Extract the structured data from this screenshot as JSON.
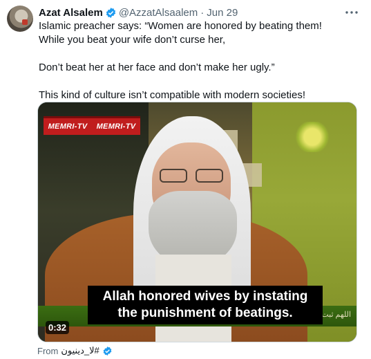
{
  "tweet": {
    "author": {
      "display_name": "Azat Alsalem",
      "handle": "@AzzatAlsaalem",
      "date": "Jun 29",
      "verified_icon": "verified-badge-icon"
    },
    "text_lines": [
      "Islamic preacher says: “Women are honored by beating them!",
      "While you beat your wife don’t curse her,",
      "Don’t beat her at her face and don’t make her ugly.”",
      "This kind of culture isn’t compatible with modern societies!"
    ],
    "media": {
      "watermark": [
        "MEMRI-TV",
        "MEMRI-TV"
      ],
      "subtitle_line1": "Allah honored wives by instating",
      "subtitle_line2": "the punishment of beatings.",
      "ticker_text": "اللهم ثبت القلعات واد شرحوا الصدر",
      "duration": "0:32"
    },
    "from": {
      "label": "From",
      "source": "لا_دينيون#"
    },
    "colors": {
      "text": "#0f1419",
      "secondary": "#536471",
      "verified": "#1d9bf0"
    }
  }
}
